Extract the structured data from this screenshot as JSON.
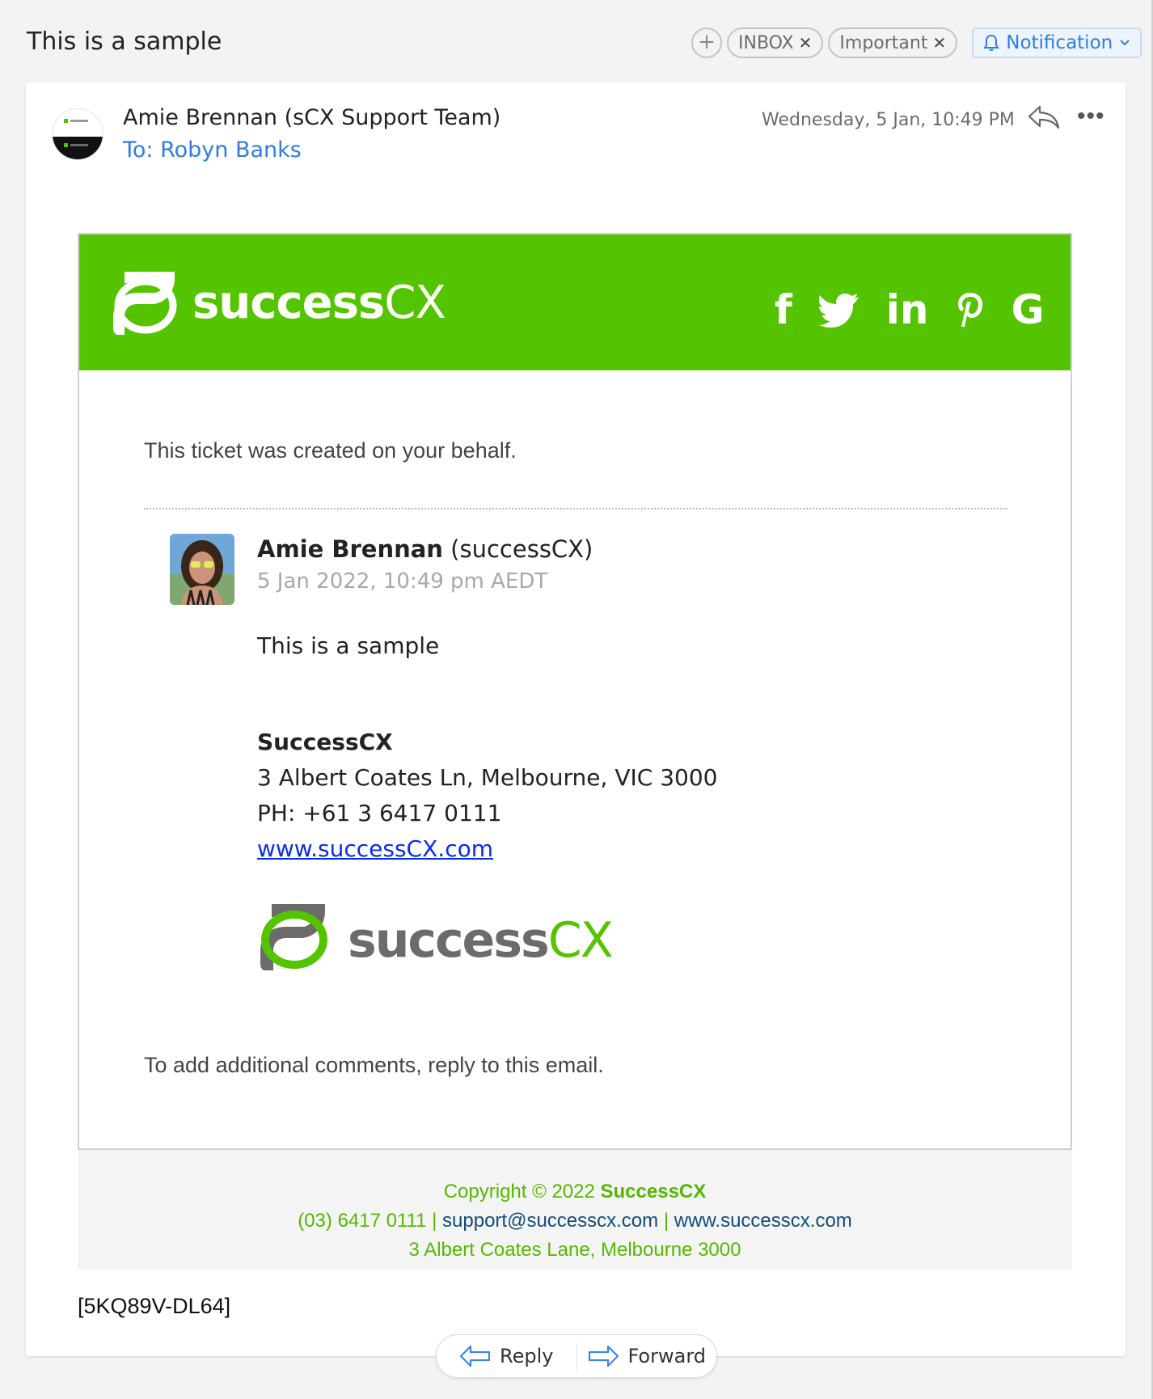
{
  "header": {
    "subject": "This is a sample",
    "tags": [
      {
        "label": "INBOX"
      },
      {
        "label": "Important"
      }
    ],
    "add_tag_glyph": "+",
    "remove_glyph": "✕",
    "notification_label": "Notification"
  },
  "message": {
    "from": "Amie Brennan (sCX Support Team)",
    "to": "To: Robyn Banks",
    "date": "Wednesday, 5 Jan, 10:49 PM",
    "more_glyph": "•••"
  },
  "email": {
    "brand": {
      "name": "success",
      "suffix": "CX",
      "bar_color": "#55c400"
    },
    "social": {
      "facebook": "f",
      "linkedin": "in",
      "google": "G"
    },
    "intro": "This ticket was created on your behalf.",
    "comment": {
      "author": "Amie Brennan",
      "org": " (successCX)",
      "date": "5 Jan 2022, 10:49 pm AEDT",
      "body": "This is a sample"
    },
    "signature": {
      "company": "SuccessCX",
      "address": "3 Albert Coates Ln, Melbourne, VIC 3000",
      "phone": "PH: +61 3 6417 0111",
      "website": "www.successCX.com"
    },
    "outro": "To add additional comments, reply to this email."
  },
  "footer": {
    "copyright_prefix": "Copyright © 2022 ",
    "copyright_company": "SuccessCX",
    "phone": "(03) 6417 0111",
    "sep": " | ",
    "email": "support@successcx.com",
    "website": "www.successcx.com",
    "address": "3 Albert Coates Lane, Melbourne 3000"
  },
  "ticket_id": "[5KQ89V-DL64]",
  "actions": {
    "reply": "Reply",
    "forward": "Forward"
  }
}
